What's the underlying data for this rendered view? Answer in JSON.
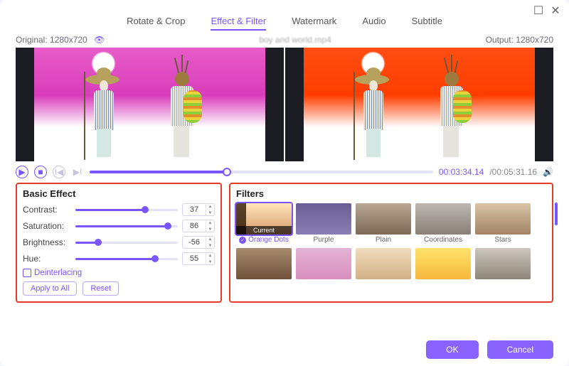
{
  "window": {
    "maximize": "☐",
    "close": "✕"
  },
  "tabs": [
    {
      "label": "Rotate & Crop",
      "active": false
    },
    {
      "label": "Effect & Filter",
      "active": true
    },
    {
      "label": "Watermark",
      "active": false
    },
    {
      "label": "Audio",
      "active": false
    },
    {
      "label": "Subtitle",
      "active": false
    }
  ],
  "info": {
    "original_label": "Original: 1280x720",
    "filename": "boy and world.mp4",
    "output_label": "Output: 1280x720"
  },
  "playback": {
    "current": "00:03:34.14",
    "total": "/00:05:31.16",
    "progress_pct": 40
  },
  "basic": {
    "title": "Basic Effect",
    "rows": [
      {
        "label": "Contrast:",
        "value": "37",
        "pct": 68
      },
      {
        "label": "Saturation:",
        "value": "86",
        "pct": 90
      },
      {
        "label": "Brightness:",
        "value": "-56",
        "pct": 22
      },
      {
        "label": "Hue:",
        "value": "55",
        "pct": 78
      }
    ],
    "deinterlacing": "Deinterlacing",
    "apply": "Apply to All",
    "reset": "Reset"
  },
  "filters": {
    "title": "Filters",
    "current_tag": "Current",
    "items": [
      {
        "label": "Orange Dots",
        "selected": true
      },
      {
        "label": "Purple"
      },
      {
        "label": "Plain"
      },
      {
        "label": "Coordinates"
      },
      {
        "label": "Stars"
      }
    ]
  },
  "footer": {
    "ok": "OK",
    "cancel": "Cancel"
  }
}
